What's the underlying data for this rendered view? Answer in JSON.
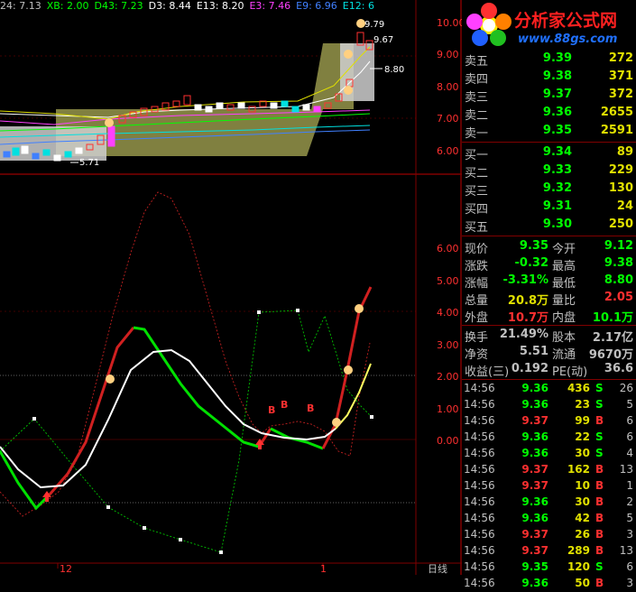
{
  "indicator_bar": [
    {
      "text": "24: 7.13",
      "color": "#c0c0c0"
    },
    {
      "text": "XB: 2.00",
      "color": "#00ff00"
    },
    {
      "text": "D43: 7.23",
      "color": "#00ff00"
    },
    {
      "text": "D3: 8.44",
      "color": "#ffffff"
    },
    {
      "text": "E13: 8.20",
      "color": "#ffffff"
    },
    {
      "text": "E3: 7.46",
      "color": "#ff40ff"
    },
    {
      "text": "E9: 6.96",
      "color": "#4080ff"
    },
    {
      "text": "E12: 6",
      "color": "#00e0e0"
    }
  ],
  "price_axis": [
    "10.00",
    "9.00",
    "8.00",
    "7.00",
    "6.00"
  ],
  "osc_axis": [
    "6.00",
    "5.00",
    "4.00",
    "3.00",
    "2.00",
    "1.00",
    "0.00"
  ],
  "price_annotations": {
    "high_label": "9.79",
    "mid_label": "9.67",
    "right_label": "8.80",
    "low_label": "5.71"
  },
  "b_markers": [
    "B",
    "B",
    "B"
  ],
  "time_axis": {
    "label_12": "12",
    "label_1": "1",
    "period": "日线"
  },
  "logo": {
    "title": "分析家公式网",
    "url": "www.88gs.com"
  },
  "order_book": {
    "asks": [
      {
        "label": "卖五",
        "price": "9.39",
        "vol": "272"
      },
      {
        "label": "卖四",
        "price": "9.38",
        "vol": "371"
      },
      {
        "label": "卖三",
        "price": "9.37",
        "vol": "372"
      },
      {
        "label": "卖二",
        "price": "9.36",
        "vol": "2655"
      },
      {
        "label": "卖一",
        "price": "9.35",
        "vol": "2591"
      }
    ],
    "bids": [
      {
        "label": "买一",
        "price": "9.34",
        "vol": "89"
      },
      {
        "label": "买二",
        "price": "9.33",
        "vol": "229"
      },
      {
        "label": "买三",
        "price": "9.32",
        "vol": "130"
      },
      {
        "label": "买四",
        "price": "9.31",
        "vol": "24"
      },
      {
        "label": "买五",
        "price": "9.30",
        "vol": "250"
      }
    ]
  },
  "quote_info": [
    {
      "k1": "现价",
      "v1": "9.35",
      "c1": "#00ff00",
      "k2": "今开",
      "v2": "9.12",
      "c2": "#00ff00"
    },
    {
      "k1": "涨跌",
      "v1": "-0.32",
      "c1": "#00ff00",
      "k2": "最高",
      "v2": "9.38",
      "c2": "#00ff00"
    },
    {
      "k1": "涨幅",
      "v1": "-3.31%",
      "c1": "#00ff00",
      "k2": "最低",
      "v2": "8.80",
      "c2": "#00ff00"
    },
    {
      "k1": "总量",
      "v1": "20.8万",
      "c1": "#e0e000",
      "k2": "量比",
      "v2": "2.05",
      "c2": "#ff3030"
    },
    {
      "k1": "外盘",
      "v1": "10.7万",
      "c1": "#ff3030",
      "k2": "内盘",
      "v2": "10.1万",
      "c2": "#00ff00"
    },
    {
      "k1": "换手",
      "v1": "21.49%",
      "c1": "#c0c0c0",
      "k2": "股本",
      "v2": "2.17亿",
      "c2": "#c0c0c0"
    },
    {
      "k1": "净资",
      "v1": "5.51",
      "c1": "#c0c0c0",
      "k2": "流通",
      "v2": "9670万",
      "c2": "#c0c0c0"
    },
    {
      "k1": "收益(三)",
      "v1": "0.192",
      "c1": "#c0c0c0",
      "k2": "PE(动)",
      "v2": "36.6",
      "c2": "#c0c0c0"
    }
  ],
  "ticks": [
    {
      "time": "14:56",
      "price": "9.36",
      "vol": "436",
      "side": "S",
      "n": "26"
    },
    {
      "time": "14:56",
      "price": "9.36",
      "vol": "23",
      "side": "S",
      "n": "5"
    },
    {
      "time": "14:56",
      "price": "9.37",
      "vol": "99",
      "side": "B",
      "n": "6"
    },
    {
      "time": "14:56",
      "price": "9.36",
      "vol": "22",
      "side": "S",
      "n": "6"
    },
    {
      "time": "14:56",
      "price": "9.36",
      "vol": "30",
      "side": "S",
      "n": "4"
    },
    {
      "time": "14:56",
      "price": "9.37",
      "vol": "162",
      "side": "B",
      "n": "13"
    },
    {
      "time": "14:56",
      "price": "9.37",
      "vol": "10",
      "side": "B",
      "n": "1"
    },
    {
      "time": "14:56",
      "price": "9.36",
      "vol": "30",
      "side": "B",
      "n": "2"
    },
    {
      "time": "14:56",
      "price": "9.36",
      "vol": "42",
      "side": "B",
      "n": "5"
    },
    {
      "time": "14:56",
      "price": "9.37",
      "vol": "26",
      "side": "B",
      "n": "3"
    },
    {
      "time": "14:56",
      "price": "9.37",
      "vol": "289",
      "side": "B",
      "n": "13"
    },
    {
      "time": "14:56",
      "price": "9.35",
      "vol": "120",
      "side": "S",
      "n": "6"
    },
    {
      "time": "14:56",
      "price": "9.36",
      "vol": "50",
      "side": "B",
      "n": "3"
    }
  ],
  "colors": {
    "up": "#ff3030",
    "down": "#00ff00",
    "grid": "#800000",
    "yellow": "#e0e000"
  }
}
